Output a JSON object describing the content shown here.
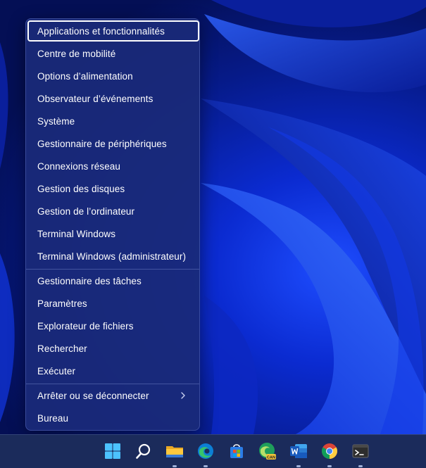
{
  "menu": {
    "items": [
      {
        "label": "Applications et fonctionnalités",
        "name": "menu-item-apps-features"
      },
      {
        "label": "Centre de mobilité",
        "name": "menu-item-mobility-center"
      },
      {
        "label": "Options d’alimentation",
        "name": "menu-item-power-options"
      },
      {
        "label": "Observateur d’événements",
        "name": "menu-item-event-viewer"
      },
      {
        "label": "Système",
        "name": "menu-item-system"
      },
      {
        "label": "Gestionnaire de périphériques",
        "name": "menu-item-device-manager"
      },
      {
        "label": "Connexions réseau",
        "name": "menu-item-network-connections"
      },
      {
        "label": "Gestion des disques",
        "name": "menu-item-disk-management"
      },
      {
        "label": "Gestion de l’ordinateur",
        "name": "menu-item-computer-management"
      },
      {
        "label": "Terminal Windows",
        "name": "menu-item-terminal"
      },
      {
        "label": "Terminal Windows (administrateur)",
        "name": "menu-item-terminal-admin"
      },
      {
        "label": "Gestionnaire des tâches",
        "name": "menu-item-task-manager"
      },
      {
        "label": "Paramètres",
        "name": "menu-item-settings"
      },
      {
        "label": "Explorateur de fichiers",
        "name": "menu-item-file-explorer"
      },
      {
        "label": "Rechercher",
        "name": "menu-item-search"
      },
      {
        "label": "Exécuter",
        "name": "menu-item-run"
      },
      {
        "label": "Arrêter ou se déconnecter",
        "name": "menu-item-shutdown-signout"
      },
      {
        "label": "Bureau",
        "name": "menu-item-desktop"
      }
    ]
  },
  "taskbar": {
    "icons": [
      {
        "name": "windows-start-icon"
      },
      {
        "name": "search-icon"
      },
      {
        "name": "file-explorer-icon"
      },
      {
        "name": "edge-icon"
      },
      {
        "name": "store-icon"
      },
      {
        "name": "edge-canary-icon",
        "badge": "CAN"
      },
      {
        "name": "word-icon"
      },
      {
        "name": "chrome-icon"
      },
      {
        "name": "terminal-icon"
      }
    ]
  },
  "colors": {
    "accent": "#0b2bd1",
    "menu_bg": "#1a2a78",
    "taskbar_bg": "#1b2b5b"
  }
}
